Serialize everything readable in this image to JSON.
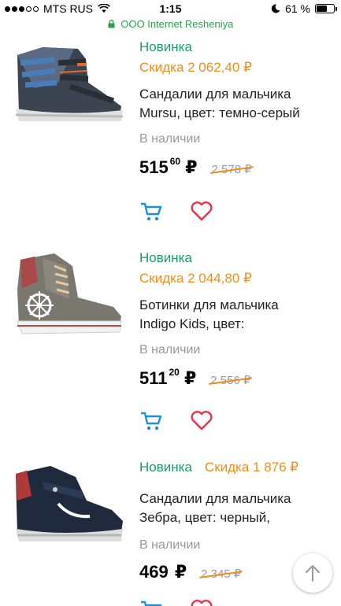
{
  "status_bar": {
    "carrier": "MTS RUS",
    "time": "1:15",
    "battery": "61 %",
    "battery_level": 0.61
  },
  "url_bar": {
    "site": "ООО Internet Resheniya"
  },
  "products": [
    {
      "badge_new": "Новинка",
      "badge_sale": "Скидка 2 062,40 ₽",
      "title_line1": "Сандалии для мальчика",
      "title_line2": "Mursu, цвет: темно-серый",
      "stock": "В наличии",
      "price_main": "515",
      "price_kop": "60",
      "price_currency": "₽",
      "old_price": "2 578 ₽"
    },
    {
      "badge_new": "Новинка",
      "badge_sale": "Скидка 2 044,80 ₽",
      "title_line1": "Ботинки для мальчика",
      "title_line2": "Indigo Kids, цвет:",
      "stock": "В наличии",
      "price_main": "511",
      "price_kop": "20",
      "price_currency": "₽",
      "old_price": "2 556 ₽"
    },
    {
      "badge_new": "Новинка",
      "badge_sale": "Скидка 1 876 ₽",
      "title_line1": "Сандалии для мальчика",
      "title_line2": "Зебра, цвет: черный,",
      "stock": "В наличии",
      "price_main": "469",
      "price_kop": "",
      "price_currency": "₽",
      "old_price": "2 345 ₽"
    }
  ],
  "icons": {
    "cart": "cart-icon",
    "favorite": "heart-icon",
    "scroll_top": "arrow-up-icon"
  },
  "colors": {
    "new_badge": "#1a9c6c",
    "sale_badge": "#f08d1e",
    "cart_icon": "#1e8fd6",
    "heart_icon": "#e8334a",
    "secure_url": "#2f9e4f"
  }
}
